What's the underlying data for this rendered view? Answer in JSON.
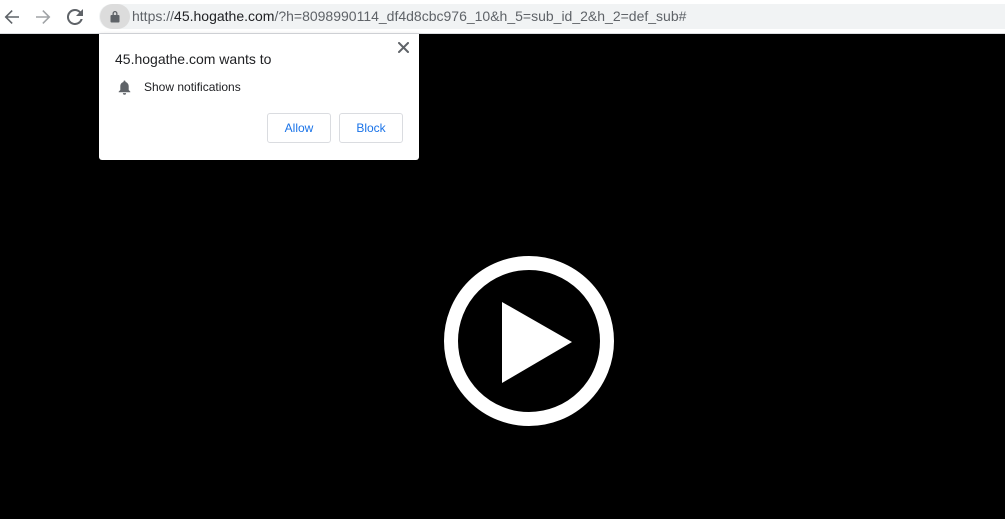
{
  "browser": {
    "url": {
      "scheme": "https://",
      "host": "45.hogathe.com",
      "rest": "/?h=8098990114_df4d8cbc976_10&h_5=sub_id_2&h_2=def_sub#"
    },
    "icons": {
      "back": "arrow-left-icon",
      "forward": "arrow-right-icon",
      "reload": "reload-icon",
      "lock": "lock-icon"
    }
  },
  "permission_prompt": {
    "title": "45.hogathe.com wants to",
    "permission_label": "Show notifications",
    "permission_icon": "bell-icon",
    "allow_label": "Allow",
    "block_label": "Block",
    "accent_color": "#1a73e8"
  },
  "player": {
    "background_color": "#000000",
    "play_icon": "play-icon"
  }
}
